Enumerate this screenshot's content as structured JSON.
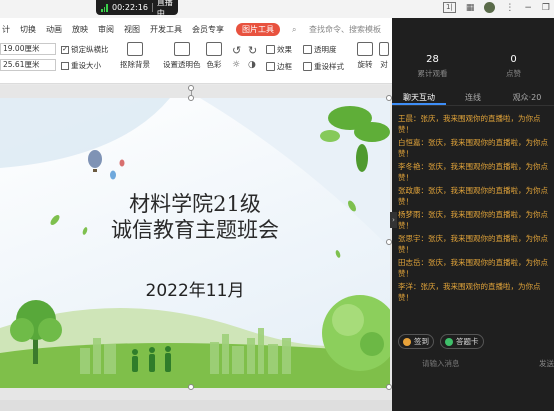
{
  "live": {
    "time": "00:22:16",
    "status": "直播中"
  },
  "menu": {
    "items": [
      "计",
      "切换",
      "动画",
      "放映",
      "审阅",
      "视图",
      "开发工具",
      "会员专享"
    ],
    "active": "图片工具",
    "search": "查找命令、搜索模板"
  },
  "ribbon": {
    "width_value": "19.00厘米",
    "height_value": "25.61厘米",
    "lock_ratio": "锁定纵横比",
    "reset_size": "重设大小",
    "remove_bg": "抠除背景",
    "set_transparent": "设置透明色",
    "color": "色彩",
    "effects": "效果",
    "transparency": "透明度",
    "border": "边框",
    "reset_style": "重设样式",
    "rotate": "旋转",
    "align": "对"
  },
  "slide": {
    "title_line1": "材料学院21级",
    "title_line2": "诚信教育主题班会",
    "date": "2022年11月"
  },
  "panel": {
    "stats": [
      {
        "value": "28",
        "label": "累计观看"
      },
      {
        "value": "0",
        "label": "点赞"
      }
    ],
    "tabs": [
      "聊天互动",
      "连线",
      "观众·20"
    ],
    "messages": [
      "王晨：张庆，我来围观你的直播啦，为你点赞！",
      "白恒嘉：张庆，我来围观你的直播啦，为你点赞！",
      "李冬艳：张庆，我来围观你的直播啦，为你点赞！",
      "张政康：张庆，我来围观你的直播啦，为你点赞！",
      "杨梦雨：张庆，我来围观你的直播啦，为你点赞！",
      "张思宇：张庆，我来围观你的直播啦，为你点赞！",
      "田志岳：张庆，我来围观你的直播啦，为你点赞！",
      "李洋：张庆，我来围观你的直播啦，为你点赞！"
    ],
    "sign_in": "签到",
    "answer_card": "答题卡",
    "input_placeholder": "请输入消息",
    "send": "发送"
  },
  "colors": {
    "accent": "#e8523f",
    "message": "#e2a43a",
    "panel_bg": "#1f1f1f",
    "tab_active": "#3e8ef7"
  }
}
